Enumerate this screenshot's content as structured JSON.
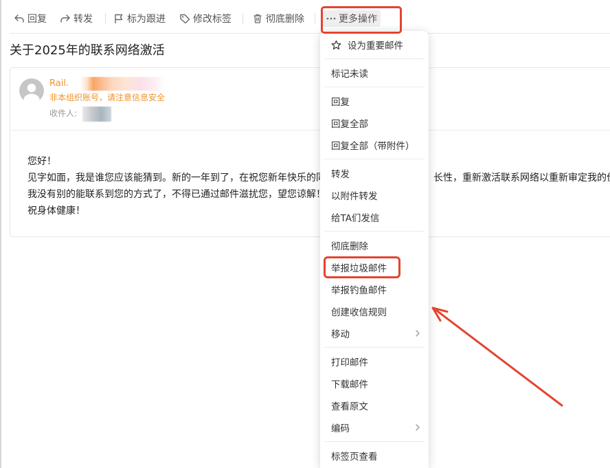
{
  "toolbar": {
    "reply": {
      "label": "回复",
      "icon": "reply-icon"
    },
    "forward": {
      "label": "转发",
      "icon": "forward-icon"
    },
    "follow_up": {
      "label": "标为跟进",
      "icon": "flag-icon"
    },
    "edit_tags": {
      "label": "修改标签",
      "icon": "tag-icon"
    },
    "delete": {
      "label": "彻底删除",
      "icon": "trash-icon"
    },
    "more": {
      "label": "更多操作",
      "icon": "more-icon",
      "active": true,
      "highlighted": true
    }
  },
  "email": {
    "subject": "关于2025年的联系网络激活",
    "avatar_icon": "avatar-icon",
    "sender_name": "Rail.",
    "external_warning": "非本组织账号，请注意信息安全",
    "recipient_label": "收件人:",
    "body": {
      "greeting": "您好！",
      "line2_left": "见字如面，我是谁您应该能猜到。新的一年到了，在祝您新年快乐的同",
      "line2_right": "长性，重新激活联系网络以重新审定我的价",
      "line3": "我没有别的能联系到您的方式了，不得已通过邮件滋扰您，望您谅解！",
      "closing": "祝身体健康！"
    }
  },
  "more_menu": {
    "groups": [
      {
        "items": [
          {
            "label": "设为重要邮件",
            "icon": "star-icon"
          }
        ]
      },
      {
        "items": [
          {
            "label": "标记未读"
          }
        ]
      },
      {
        "items": [
          {
            "label": "回复"
          },
          {
            "label": "回复全部"
          },
          {
            "label": "回复全部（带附件）"
          }
        ]
      },
      {
        "items": [
          {
            "label": "转发"
          },
          {
            "label": "以附件转发"
          },
          {
            "label": "给TA们发信"
          }
        ]
      },
      {
        "items": [
          {
            "label": "彻底删除"
          },
          {
            "label": "举报垃圾邮件",
            "highlighted": true
          },
          {
            "label": "举报钓鱼邮件"
          },
          {
            "label": "创建收信规则"
          },
          {
            "label": "移动",
            "submenu": true,
            "icon": "chevron-right-icon"
          }
        ]
      },
      {
        "items": [
          {
            "label": "打印邮件"
          },
          {
            "label": "下载邮件"
          },
          {
            "label": "查看原文"
          },
          {
            "label": "编码",
            "submenu": true,
            "icon": "chevron-right-icon"
          }
        ]
      },
      {
        "items": [
          {
            "label": "标签页查看"
          }
        ]
      }
    ]
  },
  "colors": {
    "sender_orange": "#f0932b",
    "annotation_red": "#e4432f"
  }
}
